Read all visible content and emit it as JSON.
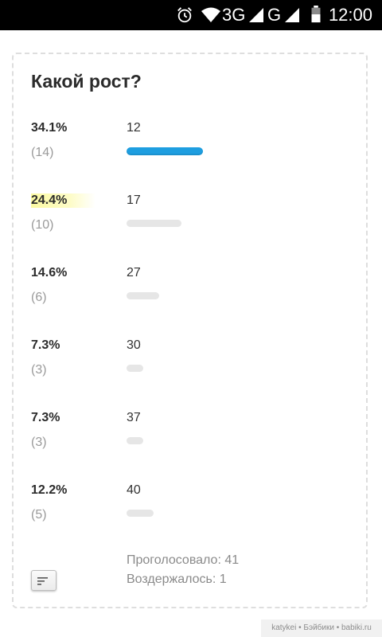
{
  "status_bar": {
    "network_3g": "3G",
    "network_g": "G",
    "time": "12:00"
  },
  "poll": {
    "title": "Какой рост?",
    "options": [
      {
        "percent": "34.1%",
        "count": "(14)",
        "label": "12",
        "share": 0.341,
        "leader": true
      },
      {
        "percent": "24.4%",
        "count": "(10)",
        "label": "17",
        "share": 0.244,
        "leader": false,
        "highlighted": true
      },
      {
        "percent": "14.6%",
        "count": "(6)",
        "label": "27",
        "share": 0.146,
        "leader": false
      },
      {
        "percent": "7.3%",
        "count": "(3)",
        "label": "30",
        "share": 0.073,
        "leader": false
      },
      {
        "percent": "7.3%",
        "count": "(3)",
        "label": "37",
        "share": 0.073,
        "leader": false
      },
      {
        "percent": "12.2%",
        "count": "(5)",
        "label": "40",
        "share": 0.122,
        "leader": false
      }
    ],
    "voted": "Проголосовало: 41",
    "abstained": "Воздержалось: 1"
  },
  "watermark": "katykei • Бэйбики • babiki.ru",
  "colors": {
    "leader_bar": "#1e9ee0",
    "other_bar": "#e6e6e6",
    "highlight": "#fcfaa3"
  }
}
